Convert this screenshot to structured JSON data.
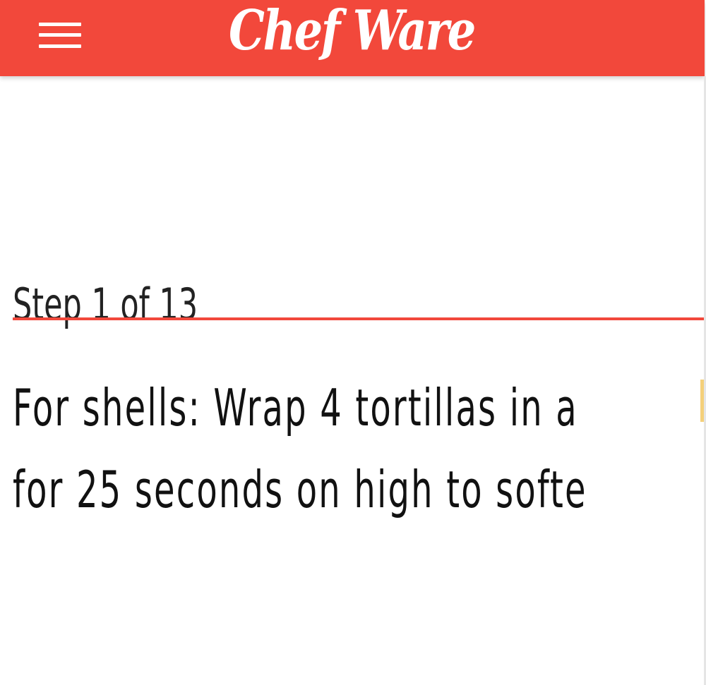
{
  "header": {
    "brand": "Chef Ware",
    "background_color": "#f2483b",
    "menu_icon": "hamburger-menu-icon"
  },
  "step": {
    "title": "Step 1 of 13",
    "accent_color": "#f2483b",
    "instruction_lines": [
      "For shells: Wrap 4 tortillas in a",
      "for 25 seconds on high to softe"
    ]
  }
}
